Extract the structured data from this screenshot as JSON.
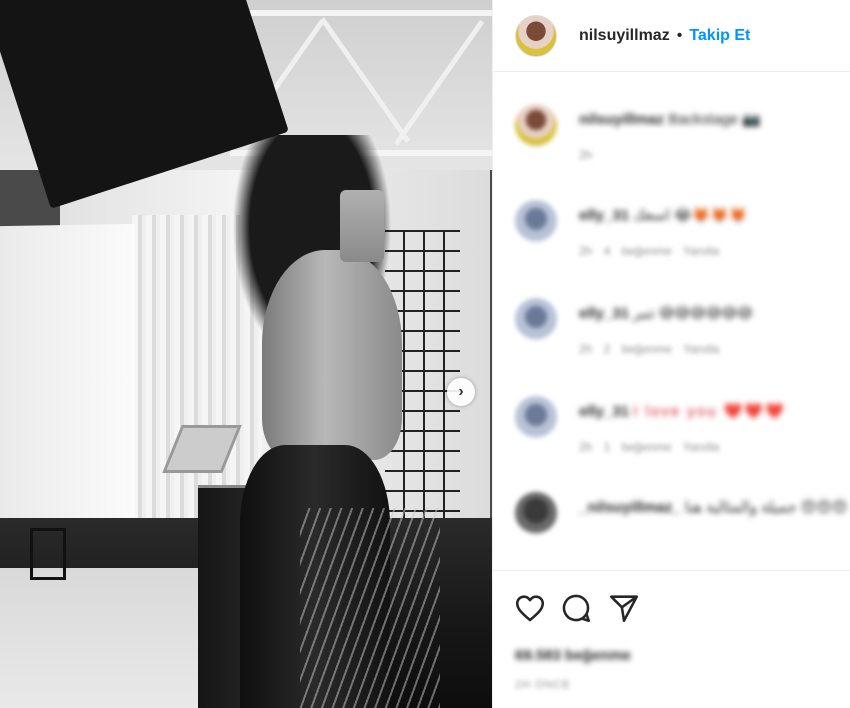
{
  "post": {
    "username": "nilsuyillmaz",
    "separator": "•",
    "follow_label": "Takip Et"
  },
  "comments": [
    {
      "user": "nilsuyillmaz",
      "text": "Backstage 📷",
      "time": "2h",
      "likes": "",
      "reply": ""
    },
    {
      "user": "elly_31",
      "text": "اسعك 😂🦊🦊🦊",
      "time": "2h",
      "likes": "4 beğenme",
      "reply": "Yanıtla"
    },
    {
      "user": "elly_31",
      "text": "تنبر 😅😅😅😅😅😅",
      "time": "2h",
      "likes": "2 beğenme",
      "reply": "Yanıtla"
    },
    {
      "user": "elly_31",
      "text": "I love you ❤️❤️❤️",
      "time": "2h",
      "likes": "1 beğenme",
      "reply": "Yanıtla"
    },
    {
      "user": "_nilsuyillmaz_",
      "text": "جميلة والمثالية هنا 😍😍😍",
      "time": "",
      "likes": "",
      "reply": ""
    }
  ],
  "footer": {
    "likes_count": "69.583 beğenme",
    "timestamp": "2H ÖNCE"
  },
  "colors": {
    "follow": "#0095f6",
    "text": "#262626",
    "muted": "#8e8e8e",
    "divider": "#efefef"
  },
  "icons": [
    "chevron-right-icon",
    "heart-icon",
    "comment-icon",
    "share-icon"
  ]
}
